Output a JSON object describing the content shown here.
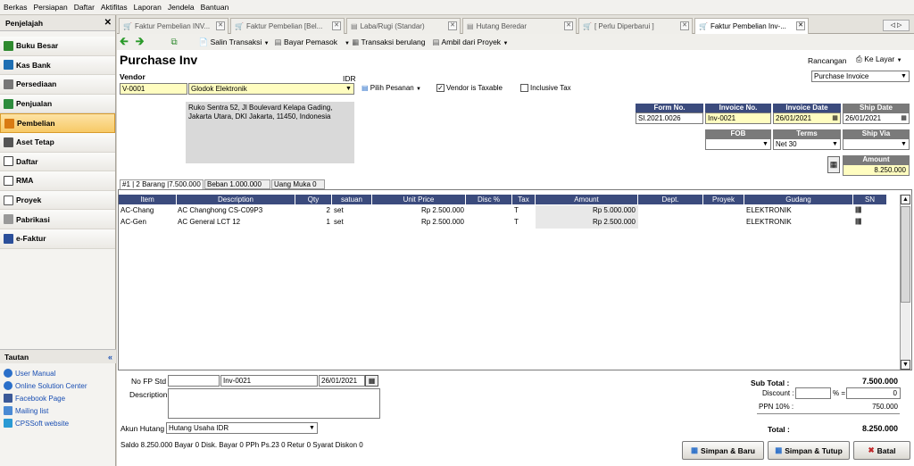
{
  "menu": [
    "Berkas",
    "Persiapan",
    "Daftar",
    "Aktifitas",
    "Laporan",
    "Jendela",
    "Bantuan"
  ],
  "sidebar": {
    "title": "Penjelajah",
    "close": "✕",
    "items": [
      {
        "label": "Buku Besar",
        "color": "#2f8a2f"
      },
      {
        "label": "Kas Bank",
        "color": "#1e6fb3"
      },
      {
        "label": "Persediaan",
        "color": "#777"
      },
      {
        "label": "Penjualan",
        "color": "#2d8c3d"
      },
      {
        "label": "Pembelian",
        "color": "#d97b12"
      },
      {
        "label": "Aset Tetap",
        "color": "#555"
      },
      {
        "label": "Daftar",
        "color": "#444"
      },
      {
        "label": "RMA",
        "color": "#444"
      },
      {
        "label": "Proyek",
        "color": "#555"
      },
      {
        "label": "Pabrikasi",
        "color": "#666"
      },
      {
        "label": "e-Faktur",
        "color": "#2b4f9a"
      }
    ],
    "tautan_title": "Tautan",
    "links": [
      {
        "label": "User Manual",
        "color": "#2a6fc9"
      },
      {
        "label": "Online Solution Center",
        "color": "#2a6fc9"
      },
      {
        "label": "Facebook Page",
        "color": "#3b5998"
      },
      {
        "label": "Mailing list",
        "color": "#4a8ad4"
      },
      {
        "label": "CPSSoft website",
        "color": "#2a9ad4"
      }
    ]
  },
  "tabs": [
    "Faktur Pembelian INV...",
    "Faktur Pembelian [Bel...",
    "Laba/Rugi (Standar)",
    "Hutang Beredar",
    "[ Perlu Diperbarui ]",
    "Faktur Pembelian Inv-..."
  ],
  "toolbar": {
    "salin": "Salin Transaksi",
    "bayar": "Bayar Pemasok",
    "berulang": "Transaksi berulang",
    "proyek": "Ambil dari Proyek"
  },
  "form": {
    "title": "Purchase Inv",
    "vendor_label": "Vendor",
    "currency": "IDR",
    "vendor_code": "V-0001",
    "vendor_name": "Glodok Elektronik",
    "pilih_pesanan": "Pilih Pesanan",
    "vendor_taxable": "Vendor is Taxable",
    "inclusive_tax": "Inclusive Tax",
    "address": "Ruko Sentra 52, Jl Boulevard Kelapa Gading, Jakarta Utara, DKI Jakarta, 11450, Indonesia",
    "rancangan_label": "Rancangan",
    "ke_layar": "Ke Layar",
    "rancangan_value": "Purchase Invoice",
    "form_no_label": "Form No.",
    "form_no": "SI.2021.0026",
    "invoice_no_label": "Invoice No.",
    "invoice_no": "Inv-0021",
    "invoice_date_label": "Invoice Date",
    "invoice_date": "26/01/2021",
    "ship_date_label": "Ship Date",
    "ship_date": "26/01/2021",
    "fob_label": "FOB",
    "fob": "",
    "terms_label": "Terms",
    "terms": "Net 30",
    "ship_via_label": "Ship Via",
    "ship_via": "",
    "amount_label": "Amount",
    "amount": "8.250.000"
  },
  "subtabs": {
    "barang": "#1 | 2 Barang |7.500.000",
    "beban": "Beban  1.000.000",
    "uang_muka": "Uang Muka  0"
  },
  "grid": {
    "columns": [
      "Item",
      "Description",
      "Qty",
      "satuan",
      "Unit Price",
      "Disc %",
      "Tax",
      "Amount",
      "Dept.",
      "Proyek",
      "Gudang",
      "SN"
    ],
    "rows": [
      {
        "item": "AC-Chang",
        "desc": "AC Changhong CS-C09P3",
        "qty": "2",
        "unit": "set",
        "price": "Rp 2.500.000",
        "disc": "",
        "tax": "T",
        "amount": "Rp 5.000.000",
        "dept": "",
        "proyek": "",
        "gudang": "ELEKTRONIK",
        "sn": "||||||||"
      },
      {
        "item": "AC-Gen",
        "desc": "AC General LCT 12",
        "qty": "1",
        "unit": "set",
        "price": "Rp 2.500.000",
        "disc": "",
        "tax": "T",
        "amount": "Rp 2.500.000",
        "dept": "",
        "proyek": "",
        "gudang": "ELEKTRONIK",
        "sn": "||||||||"
      }
    ]
  },
  "bottom": {
    "no_fp_label": "No FP Std",
    "no_fp": "",
    "no_fp_inv": "Inv-0021",
    "no_fp_date": "26/01/2021",
    "description_label": "Description",
    "akun_label": "Akun Hutang",
    "akun": "Hutang Usaha IDR",
    "status": "Saldo 8.250.000  Bayar 0  Disk. Bayar 0  PPh Ps.23 0  Retur 0  Syarat Diskon 0",
    "subtotal_label": "Sub Total :",
    "subtotal": "7.500.000",
    "discount_label": "Discount :",
    "discount_pct": "",
    "discount_pct_sym": "% =",
    "discount": "0",
    "ppn_label": "PPN 10% :",
    "ppn": "750.000",
    "total_label": "Total :",
    "total": "8.250.000"
  },
  "buttons": {
    "simpan_baru": "Simpan & Baru",
    "simpan_tutup": "Simpan & Tutup",
    "batal": "Batal"
  }
}
